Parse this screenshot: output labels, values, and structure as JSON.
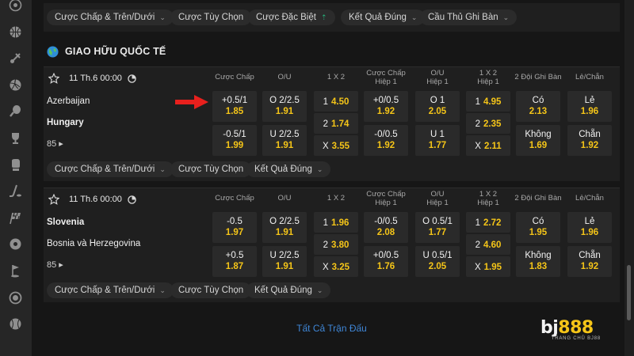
{
  "colors": {
    "accent_yellow": "#f5c518",
    "link_blue": "#3f86d6",
    "arrow_red": "#e8201d",
    "up_green": "#26b07a"
  },
  "sidebar": {
    "icons": [
      "sport-icon-1",
      "basketball-icon",
      "badminton-icon",
      "volleyball-icon",
      "tennis-icon",
      "trophy-icon",
      "boxing-icon",
      "hockey-icon",
      "racing-flag-icon",
      "ball-icon",
      "golf-icon",
      "target-icon",
      "baseball-icon"
    ]
  },
  "top_chips": [
    {
      "label": "Cược Chấp & Trên/Dưới",
      "caret": "down"
    },
    {
      "label": "Cược Tùy Chọn",
      "caret": ""
    },
    {
      "label": "Cược Đặc Biệt",
      "caret": "up"
    },
    {
      "label": "Kết Quả Đúng",
      "caret": "down"
    },
    {
      "label": "Cầu Thủ Ghi Bàn",
      "caret": "down"
    }
  ],
  "league": {
    "name": "GIAO HỮU QUỐC TẾ"
  },
  "columns": [
    {
      "l1": "Cược Chấp",
      "l2": ""
    },
    {
      "l1": "O/U",
      "l2": ""
    },
    {
      "l1": "1 X 2",
      "l2": ""
    },
    {
      "l1": "Cược Chấp",
      "l2": "Hiệp 1"
    },
    {
      "l1": "O/U",
      "l2": "Hiệp 1"
    },
    {
      "l1": "1 X 2",
      "l2": "Hiệp 1"
    },
    {
      "l1": "2 Đội Ghi Bàn",
      "l2": ""
    },
    {
      "l1": "Lẻ/Chẵn",
      "l2": ""
    }
  ],
  "matches": [
    {
      "time": "11 Th.6 00:00",
      "team1": "Azerbaijan",
      "team2": "Hungary",
      "more": "85",
      "odds": [
        [
          {
            "top": "+0.5/1",
            "bot": "1.85"
          },
          {
            "top": "-0.5/1",
            "bot": "1.99"
          }
        ],
        [
          {
            "top": "O 2/2.5",
            "bot": "1.91"
          },
          {
            "top": "U 2/2.5",
            "bot": "1.91"
          }
        ],
        [
          {
            "lbl": "1",
            "val": "4.50"
          },
          {
            "lbl": "2",
            "val": "1.74"
          },
          {
            "lbl": "X",
            "val": "3.55"
          }
        ],
        [
          {
            "top": "+0/0.5",
            "bot": "1.92"
          },
          {
            "top": "-0/0.5",
            "bot": "1.92"
          }
        ],
        [
          {
            "top": "O 1",
            "bot": "2.05"
          },
          {
            "top": "U 1",
            "bot": "1.77"
          }
        ],
        [
          {
            "lbl": "1",
            "val": "4.95"
          },
          {
            "lbl": "2",
            "val": "2.35"
          },
          {
            "lbl": "X",
            "val": "2.11"
          }
        ],
        [
          {
            "top": "Có",
            "bot": "2.13"
          },
          {
            "top": "Không",
            "bot": "1.69"
          }
        ],
        [
          {
            "top": "Lẻ",
            "bot": "1.96"
          },
          {
            "top": "Chẵn",
            "bot": "1.92"
          }
        ]
      ],
      "chips": [
        {
          "label": "Cược Chấp & Trên/Dưới",
          "caret": "down"
        },
        {
          "label": "Cược Tùy Chọn",
          "caret": ""
        },
        {
          "label": "Kết Quả Đúng",
          "caret": "down"
        }
      ]
    },
    {
      "time": "11 Th.6 00:00",
      "team1": "Slovenia",
      "team2": "Bosnia và Herzegovina",
      "more": "85",
      "odds": [
        [
          {
            "top": "-0.5",
            "bot": "1.97"
          },
          {
            "top": "+0.5",
            "bot": "1.87"
          }
        ],
        [
          {
            "top": "O 2/2.5",
            "bot": "1.91"
          },
          {
            "top": "U 2/2.5",
            "bot": "1.91"
          }
        ],
        [
          {
            "lbl": "1",
            "val": "1.96"
          },
          {
            "lbl": "2",
            "val": "3.80"
          },
          {
            "lbl": "X",
            "val": "3.25"
          }
        ],
        [
          {
            "top": "-0/0.5",
            "bot": "2.08"
          },
          {
            "top": "+0/0.5",
            "bot": "1.76"
          }
        ],
        [
          {
            "top": "O 0.5/1",
            "bot": "1.77"
          },
          {
            "top": "U 0.5/1",
            "bot": "2.05"
          }
        ],
        [
          {
            "lbl": "1",
            "val": "2.72"
          },
          {
            "lbl": "2",
            "val": "4.60"
          },
          {
            "lbl": "X",
            "val": "1.95"
          }
        ],
        [
          {
            "top": "Có",
            "bot": "1.95"
          },
          {
            "top": "Không",
            "bot": "1.83"
          }
        ],
        [
          {
            "top": "Lẻ",
            "bot": "1.96"
          },
          {
            "top": "Chẵn",
            "bot": "1.92"
          }
        ]
      ],
      "chips": [
        {
          "label": "Cược Chấp & Trên/Dưới",
          "caret": "down"
        },
        {
          "label": "Cược Tùy Chọn",
          "caret": ""
        },
        {
          "label": "Kết Quả Đúng",
          "caret": "down"
        }
      ]
    }
  ],
  "footer": {
    "all_matches": "Tất Cả Trận Đấu"
  },
  "logo": {
    "mark_left": "bj",
    "mark_right": "888",
    "sub": "TRANG CHỦ BJ88"
  }
}
